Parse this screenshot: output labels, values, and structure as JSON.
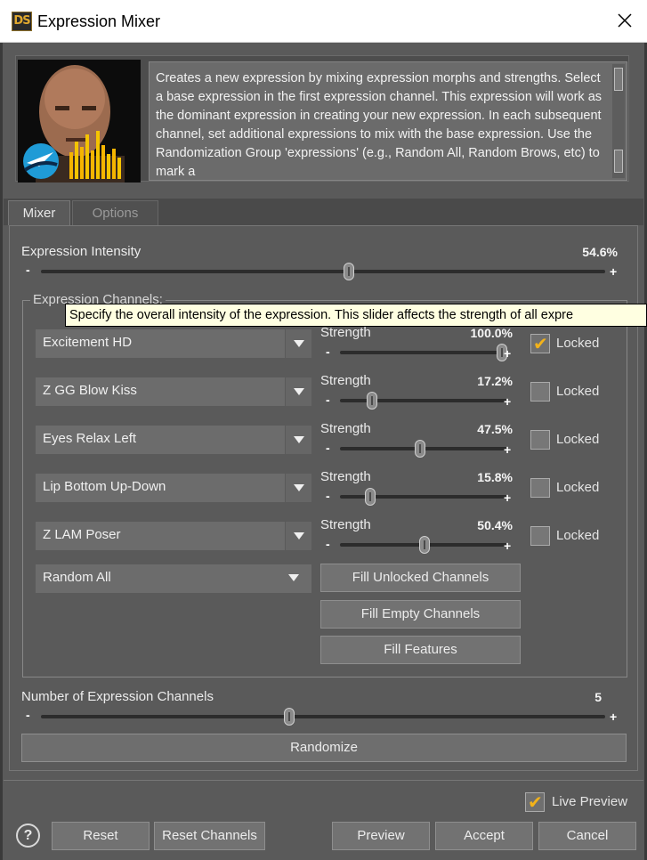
{
  "window": {
    "title": "Expression Mixer",
    "app_icon_text": "DS"
  },
  "description": "Creates a new expression by mixing expression morphs and strengths.  Select a base expression in the first expression channel.  This expression will work as the dominant expression in creating your new expression.  In each subsequent channel, set additional expressions to mix with the base expression.  Use the Randomization Group 'expressions' (e.g., Random All, Random Brows, etc) to mark a",
  "tabs": [
    {
      "label": "Mixer",
      "active": true
    },
    {
      "label": "Options",
      "active": false
    }
  ],
  "intensity": {
    "label": "Expression Intensity",
    "value_text": "54.6%",
    "value": 54.6,
    "minus": "-",
    "plus": "+"
  },
  "channels_group": {
    "title": "Expression Channels:"
  },
  "tooltip": "Specify the overall intensity of the expression.  This slider affects the strength of all expre",
  "channels": [
    {
      "name": "Excitement HD",
      "strength_label": "Strength",
      "strength_text": "100.0%",
      "strength": 100.0,
      "locked": true,
      "locked_label": "Locked",
      "minus": "-",
      "plus": "+"
    },
    {
      "name": "Z GG Blow Kiss",
      "strength_label": "Strength",
      "strength_text": "17.2%",
      "strength": 17.2,
      "locked": false,
      "locked_label": "Locked",
      "minus": "-",
      "plus": "+"
    },
    {
      "name": "Eyes Relax Left",
      "strength_label": "Strength",
      "strength_text": "47.5%",
      "strength": 47.5,
      "locked": false,
      "locked_label": "Locked",
      "minus": "-",
      "plus": "+"
    },
    {
      "name": "Lip Bottom Up-Down",
      "strength_label": "Strength",
      "strength_text": "15.8%",
      "strength": 15.8,
      "locked": false,
      "locked_label": "Locked",
      "minus": "-",
      "plus": "+"
    },
    {
      "name": "Z LAM Poser",
      "strength_label": "Strength",
      "strength_text": "50.4%",
      "strength": 50.4,
      "locked": false,
      "locked_label": "Locked",
      "minus": "-",
      "plus": "+"
    }
  ],
  "random_group": {
    "selected": "Random All"
  },
  "fill_buttons": {
    "unlocked": "Fill Unlocked Channels",
    "empty": "Fill Empty Channels",
    "features": "Fill Features"
  },
  "num_channels": {
    "label": "Number of Expression Channels",
    "value_text": "5",
    "value_fraction": 0.44,
    "minus": "-",
    "plus": "+"
  },
  "randomize_label": "Randomize",
  "live_preview": {
    "label": "Live Preview",
    "checked": true
  },
  "footer": {
    "help": "?",
    "reset": "Reset",
    "reset_channels": "Reset Channels",
    "preview": "Preview",
    "accept": "Accept",
    "cancel": "Cancel"
  },
  "colors": {
    "accent_check": "#f2b21a",
    "panel_bg": "#5a5a5a",
    "tooltip_bg": "#ffffe1"
  }
}
